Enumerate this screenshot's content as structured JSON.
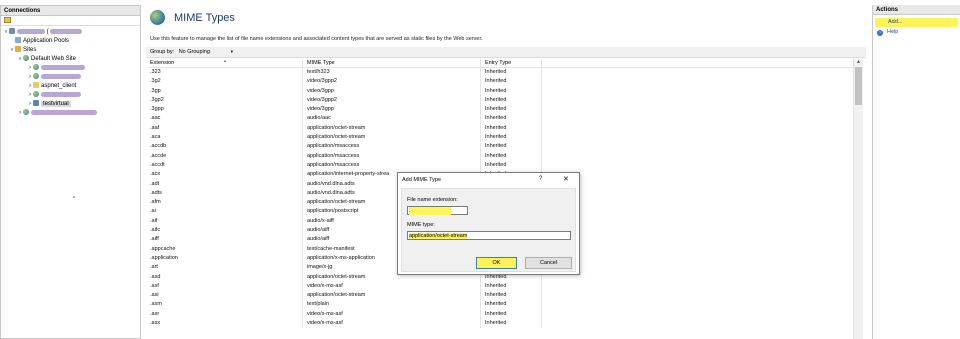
{
  "connections": {
    "title": "Connections",
    "tree": [
      {
        "id": "server",
        "label": "(",
        "expander": "v"
      },
      {
        "id": "app-pools",
        "label": "Application Pools",
        "expander": ""
      },
      {
        "id": "sites",
        "label": "Sites",
        "expander": "v"
      },
      {
        "id": "default-web-site",
        "label": "Default Web Site",
        "expander": "v"
      },
      {
        "id": "site-child-1",
        "label": "",
        "expander": ">"
      },
      {
        "id": "site-child-2",
        "label": "",
        "expander": ">"
      },
      {
        "id": "aspnet-client",
        "label": "aspnet_client",
        "expander": ">"
      },
      {
        "id": "site-child-3",
        "label": "",
        "expander": ">"
      },
      {
        "id": "testvirtual",
        "label": "testvirtual",
        "expander": ">"
      },
      {
        "id": "site-2",
        "label": "",
        "expander": ">"
      }
    ]
  },
  "main": {
    "title": "MIME Types",
    "description": "Use this feature to manage the list of file name extensions and associated content types that are served as static files by the Web server.",
    "group_by_label": "Group by:",
    "group_by_value": "No Grouping",
    "columns": [
      "Extension",
      "MIME Type",
      "Entry Type"
    ],
    "rows": [
      [
        ".323",
        "text/h323",
        "Inherited"
      ],
      [
        ".3g2",
        "video/3gpp2",
        "Inherited"
      ],
      [
        ".3gp",
        "video/3gpp",
        "Inherited"
      ],
      [
        ".3gp2",
        "video/3gpp2",
        "Inherited"
      ],
      [
        ".3gpp",
        "video/3gpp",
        "Inherited"
      ],
      [
        ".aac",
        "audio/aac",
        "Inherited"
      ],
      [
        ".aaf",
        "application/octet-stream",
        "Inherited"
      ],
      [
        ".aca",
        "application/octet-stream",
        "Inherited"
      ],
      [
        ".accdb",
        "application/msaccess",
        "Inherited"
      ],
      [
        ".accde",
        "application/msaccess",
        "Inherited"
      ],
      [
        ".accdt",
        "application/msaccess",
        "Inherited"
      ],
      [
        ".acx",
        "application/internet-property-strea",
        "Inherited"
      ],
      [
        ".adt",
        "audio/vnd.dlna.adts",
        "Inherited"
      ],
      [
        ".adts",
        "audio/vnd.dlna.adts",
        "Inherited"
      ],
      [
        ".afm",
        "application/octet-stream",
        "Inherited"
      ],
      [
        ".ai",
        "application/postscript",
        "Inherited"
      ],
      [
        ".aif",
        "audio/x-aiff",
        "Inherited"
      ],
      [
        ".aifc",
        "audio/aiff",
        "Inherited"
      ],
      [
        ".aiff",
        "audio/aiff",
        "Inherited"
      ],
      [
        ".appcache",
        "text/cache-manifest",
        "Inherited"
      ],
      [
        ".application",
        "application/x-ms-application",
        "Inherited"
      ],
      [
        ".art",
        "image/x-jg",
        "Inherited"
      ],
      [
        ".asd",
        "application/octet-stream",
        "Inherited"
      ],
      [
        ".asf",
        "video/x-ms-asf",
        "Inherited"
      ],
      [
        ".asi",
        "application/octet-stream",
        "Inherited"
      ],
      [
        ".asm",
        "text/plain",
        "Inherited"
      ],
      [
        ".asr",
        "video/x-ms-asf",
        "Inherited"
      ],
      [
        ".asx",
        "video/x-ms-asf",
        "Inherited"
      ]
    ]
  },
  "actions": {
    "title": "Actions",
    "add_label": "Add...",
    "help_label": "Help"
  },
  "dialog": {
    "title": "Add MIME Type",
    "help_glyph": "?",
    "close_glyph": "✕",
    "ext_label": "File name extension:",
    "ext_value": ".",
    "mime_label": "MIME type:",
    "mime_value": "application/octet-stream",
    "ok_label": "OK",
    "cancel_label": "Cancel"
  },
  "colors": {
    "highlight": "#fff35a",
    "link": "#1f4a9a",
    "redaction": "#b7a7d4"
  }
}
